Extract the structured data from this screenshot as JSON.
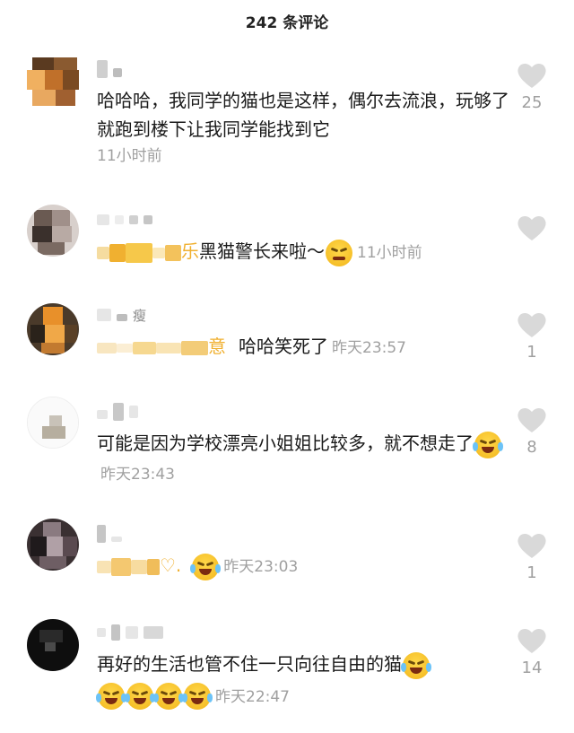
{
  "header": {
    "title": "242 条评论"
  },
  "comments": [
    {
      "text": "哈哈哈，我同学的猫也是这样，偶尔去流浪，玩够了就跑到楼下让我同学能找到它",
      "time": "11小时前",
      "likes": "25"
    },
    {
      "text_partial": "乐",
      "text": "黑猫警长来啦～",
      "time": "11小时前",
      "likes": ""
    },
    {
      "name_partial": "瘦",
      "text_partial": "意",
      "text": "哈哈笑死了",
      "time": "昨天23:57",
      "likes": "1"
    },
    {
      "text": "可能是因为学校漂亮小姐姐比较多，就不想走了",
      "time": "昨天23:43",
      "likes": "8"
    },
    {
      "text_partial": "♡.",
      "text": "",
      "time": "昨天23:03",
      "likes": "1"
    },
    {
      "text": "再好的生活也管不住一只向往自由的猫",
      "time": "昨天22:47",
      "likes": "14"
    }
  ],
  "icons": {
    "like": "heart-icon",
    "emoji_laugh": "laughing-tears-emoji",
    "emoji_smug": "smug-emoji"
  }
}
